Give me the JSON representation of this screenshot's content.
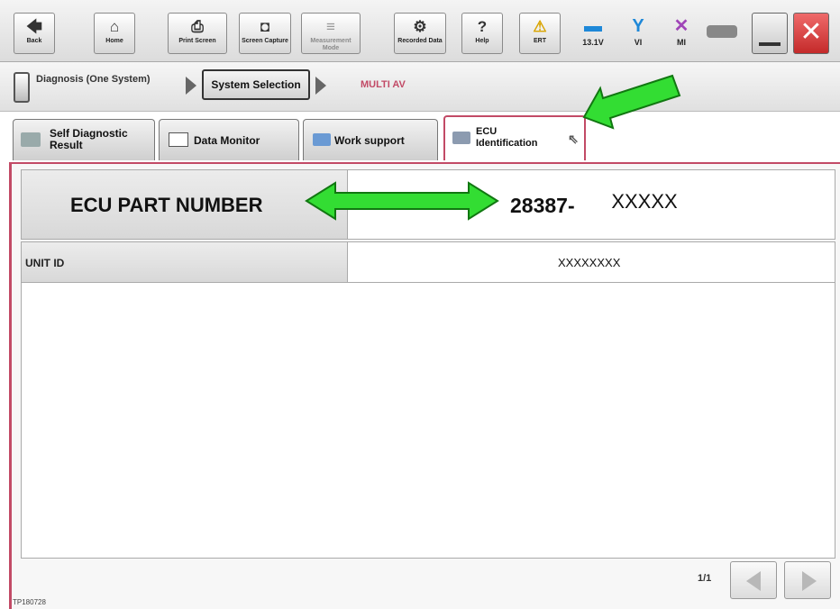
{
  "toolbar": {
    "buttons": [
      {
        "label": "Back",
        "icon": "back-arrow-icon",
        "glyph": "🡄"
      },
      {
        "label": "Home",
        "icon": "home-icon",
        "glyph": "⌂"
      },
      {
        "label": "Print Screen",
        "icon": "printer-icon",
        "glyph": "⎙"
      },
      {
        "label": "Screen Capture",
        "icon": "camera-icon",
        "glyph": "◘"
      },
      {
        "label": "Measurement Mode",
        "icon": "measurement-icon",
        "glyph": "≡"
      },
      {
        "label": "Recorded Data",
        "icon": "recorded-data-icon",
        "glyph": "⚙"
      },
      {
        "label": "Help",
        "icon": "help-icon",
        "glyph": "?"
      },
      {
        "label": "ERT",
        "icon": "warning-icon",
        "glyph": "⚠"
      }
    ],
    "status": [
      {
        "label": "13.1V",
        "icon": "car-battery-icon",
        "glyph": "▬"
      },
      {
        "label": "VI",
        "icon": "signal-icon",
        "glyph": "Y"
      },
      {
        "label": "MI",
        "icon": "mi-status-icon",
        "glyph": "✕"
      }
    ]
  },
  "breadcrumb": {
    "step1": "Diagnosis (One System)",
    "step2": "System Selection",
    "step3": "MULTI AV"
  },
  "tabs": [
    {
      "label": "Self Diagnostic Result",
      "icon": "self-diagnostic-icon"
    },
    {
      "label": "Data Monitor",
      "icon": "data-monitor-icon"
    },
    {
      "label": "Work support",
      "icon": "work-support-icon"
    },
    {
      "label": "ECU Identification",
      "icon": "ecu-identification-icon"
    }
  ],
  "ecu": {
    "part_number_label": "ECU PART NUMBER",
    "part_number_value_prefix": "28387-",
    "part_number_value_masked": "XXXXX",
    "unit_id_label": "UNIT ID",
    "unit_id_value": "XXXXXXXX"
  },
  "pager": {
    "text": "1/1"
  },
  "footer": {
    "code": "TP180728"
  },
  "colors": {
    "accent": "#c24a66",
    "callout": "#33cc33",
    "close": "#d63a3a"
  }
}
